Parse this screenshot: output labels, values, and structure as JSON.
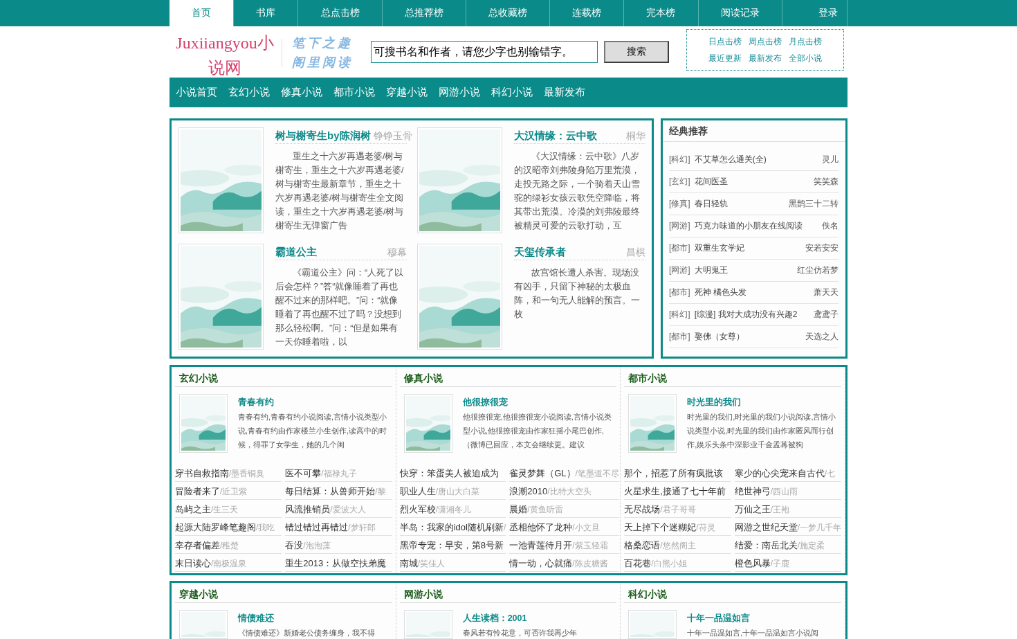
{
  "top_nav": {
    "items": [
      {
        "label": "首页",
        "selected": true
      },
      {
        "label": "书库",
        "selected": false
      },
      {
        "label": "总点击榜",
        "selected": false
      },
      {
        "label": "总推荐榜",
        "selected": false
      },
      {
        "label": "总收藏榜",
        "selected": false
      },
      {
        "label": "连载榜",
        "selected": false
      },
      {
        "label": "完本榜",
        "selected": false
      },
      {
        "label": "阅读记录",
        "selected": false
      }
    ],
    "login": "登录"
  },
  "header": {
    "logo": "Juxiiangyou小说网",
    "slogan": [
      "笔下之趣",
      "阁里阅读"
    ],
    "search": {
      "value": "可搜书名和作者，请您少字也别输错字。",
      "button": "搜索"
    },
    "rank_links": [
      "日点击榜",
      "周点击榜",
      "月点击榜",
      "最近更新",
      "最新发布",
      "全部小说"
    ]
  },
  "category_nav": [
    "小说首页",
    "玄幻小说",
    "修真小说",
    "都市小说",
    "穿越小说",
    "网游小说",
    "科幻小说",
    "最新发布"
  ],
  "featured": [
    {
      "title": "树与榭寄生by陈润树",
      "author": "铮铮玉骨",
      "intro": "重生之十六岁再遇老婆/树与榭寄生，重生之十六岁再遇老婆/树与榭寄生最新章节，重生之十六岁再遇老婆/树与榭寄生全文阅读，重生之十六岁再遇老婆/树与榭寄生无弹窗广告"
    },
    {
      "title": "大汉情缘：云中歌",
      "author": "桐华",
      "intro": "《大汉情缘：云中歌》八岁的汉昭帝刘弗陵身陷万里荒漠，走投无路之际，一个骑着天山雪驼的绿衫女孩云歌凭空降临，将其带出荒漠。冷漠的刘弗陵最终被精灵可爱的云歌打动，互"
    },
    {
      "title": "霸道公主",
      "author": "穆幕",
      "intro": "《霸道公主》问：“人死了以后会怎样？”答“就像睡着了再也醒不过来的那样吧。”问：“就像睡着了再也醒不过了吗？没想到那么轻松啊。”问：“但是如果有一天你睡着啦，以"
    },
    {
      "title": "天玺传承者",
      "author": "昌棋",
      "intro": "故宫馆长遭人杀害。现场没有凶手，只留下神秘的太极血阵，和一句无人能解的预言。一枚"
    }
  ],
  "classic": {
    "title": "经典推荐",
    "items": [
      {
        "category": "[科幻]",
        "title": "不艾草怎么通关(全)",
        "author": "灵儿"
      },
      {
        "category": "[玄幻]",
        "title": "花间医圣",
        "author": "笑笑森"
      },
      {
        "category": "[修真]",
        "title": "春日轻轨",
        "author": "黑鹊三十二转"
      },
      {
        "category": "[网游]",
        "title": "巧克力味道的小朋友在线阅读",
        "author": "佚名"
      },
      {
        "category": "[都市]",
        "title": "双重生玄学妃",
        "author": "安若安安"
      },
      {
        "category": "[网游]",
        "title": "大明鬼王",
        "author": "红尘仿若梦"
      },
      {
        "category": "[都市]",
        "title": "死神 橘色头发",
        "author": "萧天天"
      },
      {
        "category": "[科幻]",
        "title": "[综漫] 我对大成功没有兴趣2",
        "author": "鸢鸢子"
      },
      {
        "category": "[都市]",
        "title": "娶佛（女尊）",
        "author": "天选之人"
      }
    ]
  },
  "sections": [
    {
      "title": "玄幻小说",
      "feature": {
        "title": "青春有约",
        "intro": "青春有约,青春有约小说阅读,言情小说类型小说,青春有约由作家楼兰小生创作,读高中的时候，得罪了女学生，她的几个闺"
      },
      "books": [
        {
          "title": "穿书自救指南",
          "author": "/墨香铜臭"
        },
        {
          "title": "医不可攀",
          "author": "/福禄丸子"
        },
        {
          "title": "冒险者来了",
          "author": "/近卫紫"
        },
        {
          "title": "每日结算：从兽师开始",
          "author": "/黎"
        },
        {
          "title": "岛屿之主",
          "author": "/生三天"
        },
        {
          "title": "风流推销员",
          "author": "/爱波大人"
        },
        {
          "title": "起源大陆罗峰笔趣阁",
          "author": "/我吃"
        },
        {
          "title": "错过错过再错过",
          "author": "/梦轩郎"
        },
        {
          "title": "幸存者偏差",
          "author": "/稚楚"
        },
        {
          "title": "吞没",
          "author": "/泡泡藻"
        },
        {
          "title": "末日读心",
          "author": "/南极温泉"
        },
        {
          "title": "重生2013：从做空扶弟魔"
        }
      ]
    },
    {
      "title": "修真小说",
      "feature": {
        "title": "他很撩很宠",
        "intro": "他很撩很宠,他很撩很宠小说阅读,言情小说类型小说,他很撩很宠由作家狂摇小尾巴创作,（微博已回应，本文会继续更。建议"
      },
      "books": [
        {
          "title": "快穿：笨蛋美人被迫成为"
        },
        {
          "title": "雀灵梦舞（GL）",
          "author": "/笔墨道不尽"
        },
        {
          "title": "职业人生",
          "author": "/唐山大白菜"
        },
        {
          "title": "浪潮2010",
          "author": "/比特大空头"
        },
        {
          "title": "烈火军校",
          "author": "/潇湘冬儿"
        },
        {
          "title": "晨婚",
          "author": "/黄鱼听雷"
        },
        {
          "title": "半岛：我家的idol随机刷新",
          "author": "/"
        },
        {
          "title": "丞相他怀了龙种",
          "author": "/小文旦"
        },
        {
          "title": "黑帝专宠：早安，第8号新"
        },
        {
          "title": "一池青莲待月开",
          "author": "/紫玉轻霜"
        },
        {
          "title": "南城",
          "author": "/笑佳人"
        },
        {
          "title": "情一动，心就痛",
          "author": "/陈皮糖酱"
        }
      ]
    },
    {
      "title": "都市小说",
      "feature": {
        "title": "时光里的我们",
        "intro": "时光里的我们,时光里的我们小说阅读,言情小说类型小说,时光里的我们由作家匿风而行创作,娱乐头条中深影业千金孟苒被狗"
      },
      "books": [
        {
          "title": "那个，招惹了所有疯批该"
        },
        {
          "title": "寒少的心尖宠来自古代",
          "author": "/七"
        },
        {
          "title": "火星求生,接通了七十年前"
        },
        {
          "title": "绝世神弓",
          "author": "/西山雨"
        },
        {
          "title": "无尽战场",
          "author": "/君子哥哥"
        },
        {
          "title": "万仙之王",
          "author": "/王袍"
        },
        {
          "title": "天上掉下个迷糊妃",
          "author": "/苻灵"
        },
        {
          "title": "网游之世纪天堂",
          "author": "/一梦几千年"
        },
        {
          "title": "格桑恋语",
          "author": "/悠然阁主"
        },
        {
          "title": "结爱：南岳北关",
          "author": "/施定柔"
        },
        {
          "title": "百花巷",
          "author": "/白熊小姐"
        },
        {
          "title": "橙色风暴",
          "author": "/子鹿"
        }
      ]
    },
    {
      "title": "穿越小说",
      "feature": {
        "title": "情债难还",
        "intro": "《情债难还》新婚老公债务缠身，我不得"
      }
    },
    {
      "title": "网游小说",
      "feature": {
        "title": "人生读档：2001",
        "intro": "春风若有怜花意，可否许我再少年"
      }
    },
    {
      "title": "科幻小说",
      "feature": {
        "title": "十年一品温如言",
        "intro": "十年一品温如言,十年一品温如言小说阅"
      }
    }
  ]
}
